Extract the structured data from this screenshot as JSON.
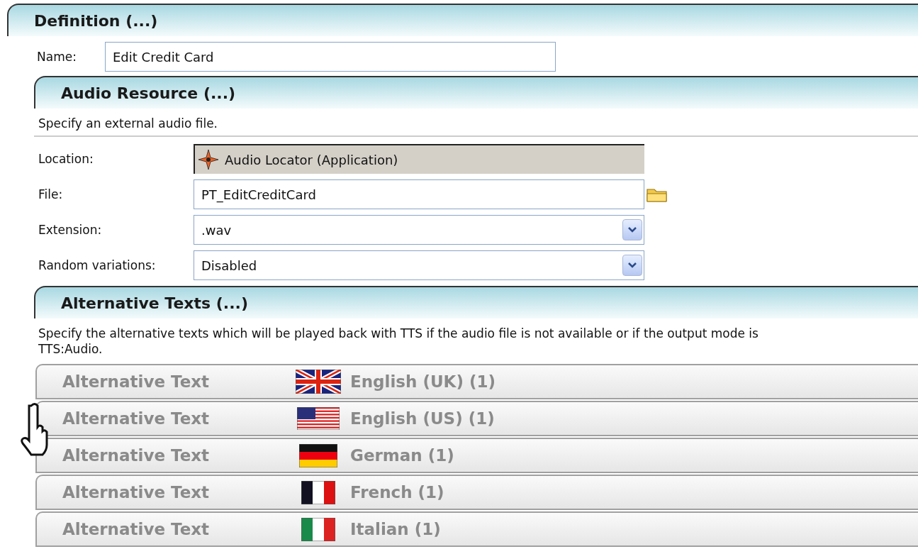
{
  "definition": {
    "title": "Definition (...)",
    "name_label": "Name:",
    "name_value": "Edit Credit Card"
  },
  "audio_resource": {
    "title": "Audio Resource (...)",
    "description": "Specify an external audio file.",
    "fields": [
      {
        "kind": "locator",
        "label": "Location:",
        "value": "Audio Locator (Application)"
      },
      {
        "kind": "file",
        "label": "File:",
        "value": "PT_EditCreditCard"
      },
      {
        "kind": "dropdown",
        "label": "Extension:",
        "value": ".wav"
      },
      {
        "kind": "dropdown",
        "label": "Random variations:",
        "value": "Disabled"
      }
    ]
  },
  "alternative_texts": {
    "title": "Alternative Texts (...)",
    "description": "Specify the alternative texts which will be played back with TTS if the audio file is not available or if the output mode is TTS:Audio.",
    "rows": [
      {
        "label": "Alternative Text",
        "kind": "uk",
        "language": "English (UK) (1)"
      },
      {
        "label": "Alternative Text",
        "kind": "us",
        "language": "English (US) (1)"
      },
      {
        "label": "Alternative Text",
        "kind": "de",
        "language": "German (1)"
      },
      {
        "label": "Alternative Text",
        "kind": "fr",
        "language": "French (1)"
      },
      {
        "label": "Alternative Text",
        "kind": "it",
        "language": "Italian (1)"
      }
    ]
  }
}
